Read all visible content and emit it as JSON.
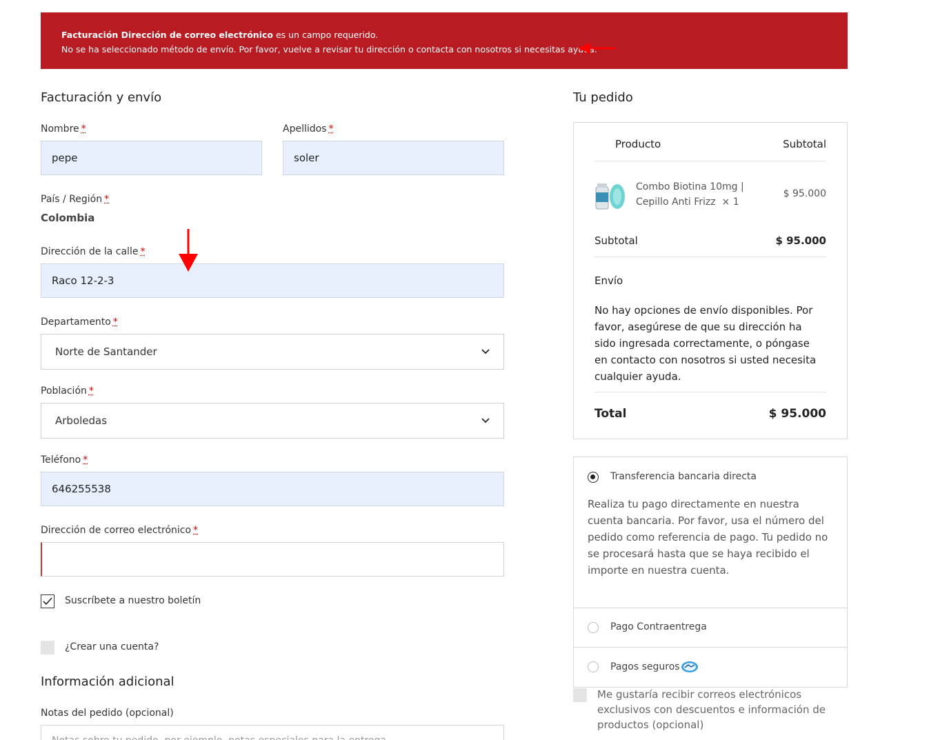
{
  "banner": {
    "line1_bold": "Facturación Dirección de correo electrónico",
    "line1_rest": " es un campo requerido.",
    "line2": "No se ha seleccionado método de envío. Por favor, vuelve a revisar tu dirección o contacta con nosotros si necesitas ayuda."
  },
  "billing": {
    "title": "Facturación y envío",
    "required_mark": "*",
    "first_name": {
      "label": "Nombre",
      "value": "pepe"
    },
    "last_name": {
      "label": "Apellidos",
      "value": "soler"
    },
    "country": {
      "label": "País / Región",
      "value": "Colombia"
    },
    "street": {
      "label": "Dirección de la calle",
      "value": "Raco 12-2-3"
    },
    "state": {
      "label": "Departamento",
      "value": "Norte de Santander"
    },
    "city": {
      "label": "Población",
      "value": "Arboledas"
    },
    "phone": {
      "label": "Teléfono",
      "value": "646255538"
    },
    "email": {
      "label": "Dirección de correo electrónico",
      "value": ""
    },
    "newsletter": {
      "label": "Suscríbete a nuestro boletín",
      "checked": true
    },
    "create_account": {
      "label": "¿Crear una cuenta?",
      "checked": false
    }
  },
  "additional": {
    "title": "Información adicional",
    "notes_label": "Notas del pedido (opcional)",
    "notes_placeholder": "Notas sobre tu pedido, por ejemplo, notas especiales para la entrega."
  },
  "order": {
    "title": "Tu pedido",
    "col_product": "Producto",
    "col_subtotal": "Subtotal",
    "item_name": "Combo Biotina 10mg | Cepillo Anti Frizz",
    "item_qty": "× 1",
    "item_price": "$ 95.000",
    "subtotal_label": "Subtotal",
    "subtotal_value": "$ 95.000",
    "shipping_label": "Envío",
    "shipping_message": "No hay opciones de envío disponibles. Por favor, asegúrese de que su dirección ha sido ingresada correctamente, o póngase en contacto con nosotros si usted necesita cualquier ayuda.",
    "total_label": "Total",
    "total_value": "$ 95.000"
  },
  "payment": {
    "methods": [
      {
        "label": "Transferencia bancaria directa",
        "selected": true
      },
      {
        "label": "Pago Contraentrega",
        "selected": false
      },
      {
        "label": "Pagos seguros",
        "selected": false
      }
    ],
    "description": "Realiza tu pago directamente en nuestra cuenta bancaria. Por favor, usa el número del pedido como referencia de pago. Tu pedido no se procesará hasta que se haya recibido el importe en nuestra cuenta.",
    "optin_label": "Me gustaría recibir correos electrónicos exclusivos con descuentos e información de productos (opcional)"
  },
  "colors": {
    "banner_bg": "#b81c22",
    "autofill_bg": "#e8f0fe",
    "annotation_arrow": "#ff0000"
  }
}
